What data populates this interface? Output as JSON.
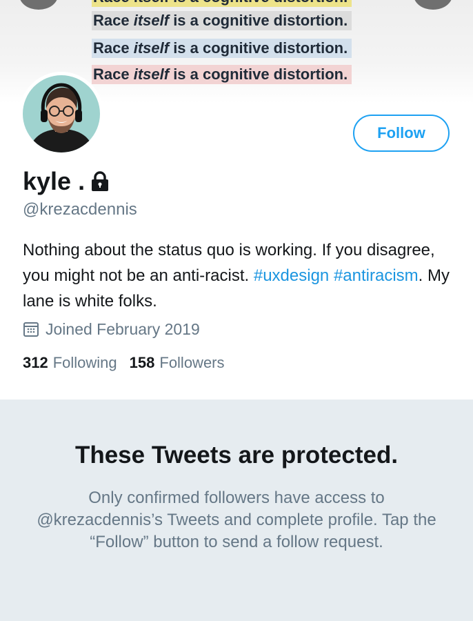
{
  "banner": {
    "line_top": "Race itself is a cognitive distortion.",
    "lines": [
      {
        "pre": "Race ",
        "ital": "itself",
        "post": " is a cognitive distortion."
      },
      {
        "pre": "Race ",
        "ital": "itself",
        "post": " is a cognitive distortion."
      },
      {
        "pre": "Race ",
        "ital": "itself",
        "post": " is a cognitive distortion."
      }
    ],
    "highlight_colors": [
      "#ede38a",
      "#dcdcdc",
      "#d3e0ec",
      "#f2d3d3"
    ]
  },
  "profile": {
    "display_name": "kyle .",
    "handle": "@krezacdennis",
    "follow_label": "Follow",
    "locked_icon": "lock-icon",
    "bio": {
      "text1": "Nothing about the status quo is working. If you disagree, you might not be an anti-racist. ",
      "hashtag1": "#uxdesign",
      "hashtag2": "#antiracism",
      "text2": ". My lane is white folks."
    },
    "joined": "Joined February 2019",
    "following_count": "312",
    "following_label": "Following",
    "followers_count": "158",
    "followers_label": "Followers"
  },
  "protected": {
    "title": "These Tweets are protected.",
    "message": "Only confirmed followers have access to @krezacdennis’s Tweets and complete profile. Tap the “Follow” button to send a follow request."
  },
  "colors": {
    "accent": "#1da1f2",
    "link": "#1b95e0",
    "secondary_text": "#657786",
    "protected_bg": "#e6ecf0"
  }
}
